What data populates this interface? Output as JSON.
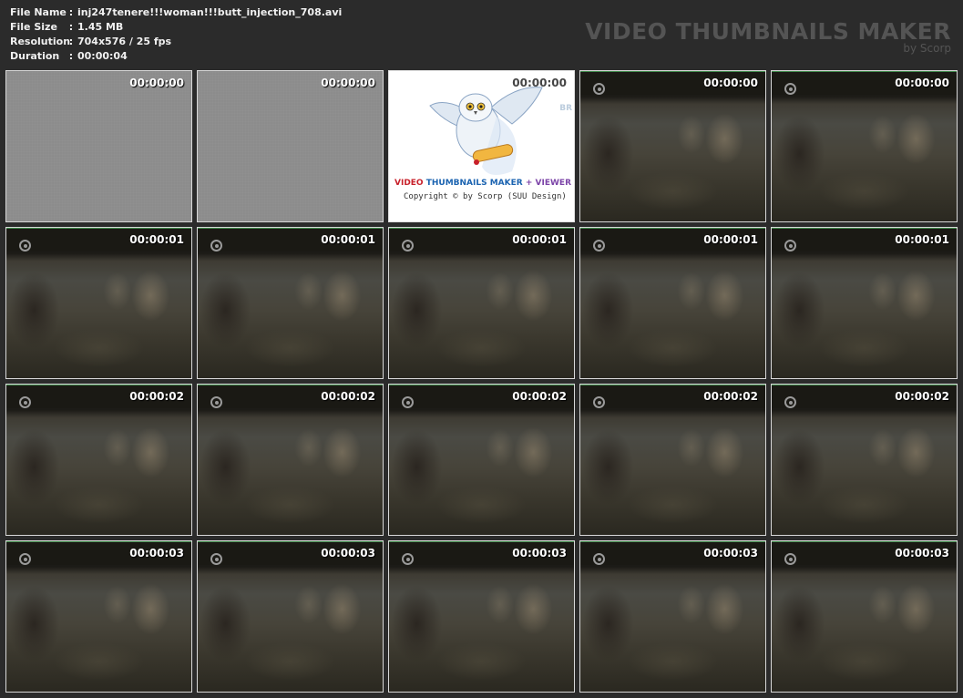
{
  "file_info": [
    {
      "key": "File Name",
      "value": "inj247tenere!!!woman!!!butt_injection_708.avi"
    },
    {
      "key": "File Size",
      "value": "1.45 MB"
    },
    {
      "key": "Resolution",
      "value": "704x576 / 25 fps"
    },
    {
      "key": "Duration",
      "value": "00:00:04"
    }
  ],
  "separator": ":",
  "brand": {
    "title": "VIDEO THUMBNAILS MAKER",
    "by": "by Scorp"
  },
  "splash": {
    "title_red": "VIDEO",
    "title_blue": "THUMBNAILS MAKER",
    "title_plus": "+",
    "title_purple": "VIEWER",
    "copyright": "Copyright © by Scorp (SUU Design)",
    "side_text": "BR"
  },
  "thumbnails": [
    {
      "time": "00:00:00",
      "kind": "gray"
    },
    {
      "time": "00:00:00",
      "kind": "gray"
    },
    {
      "time": "00:00:00",
      "kind": "splash"
    },
    {
      "time": "00:00:00",
      "kind": "video"
    },
    {
      "time": "00:00:00",
      "kind": "video"
    },
    {
      "time": "00:00:01",
      "kind": "video"
    },
    {
      "time": "00:00:01",
      "kind": "video"
    },
    {
      "time": "00:00:01",
      "kind": "video"
    },
    {
      "time": "00:00:01",
      "kind": "video"
    },
    {
      "time": "00:00:01",
      "kind": "video"
    },
    {
      "time": "00:00:02",
      "kind": "video"
    },
    {
      "time": "00:00:02",
      "kind": "video"
    },
    {
      "time": "00:00:02",
      "kind": "video"
    },
    {
      "time": "00:00:02",
      "kind": "video"
    },
    {
      "time": "00:00:02",
      "kind": "video"
    },
    {
      "time": "00:00:03",
      "kind": "video"
    },
    {
      "time": "00:00:03",
      "kind": "video"
    },
    {
      "time": "00:00:03",
      "kind": "video"
    },
    {
      "time": "00:00:03",
      "kind": "video"
    },
    {
      "time": "00:00:03",
      "kind": "video"
    }
  ]
}
